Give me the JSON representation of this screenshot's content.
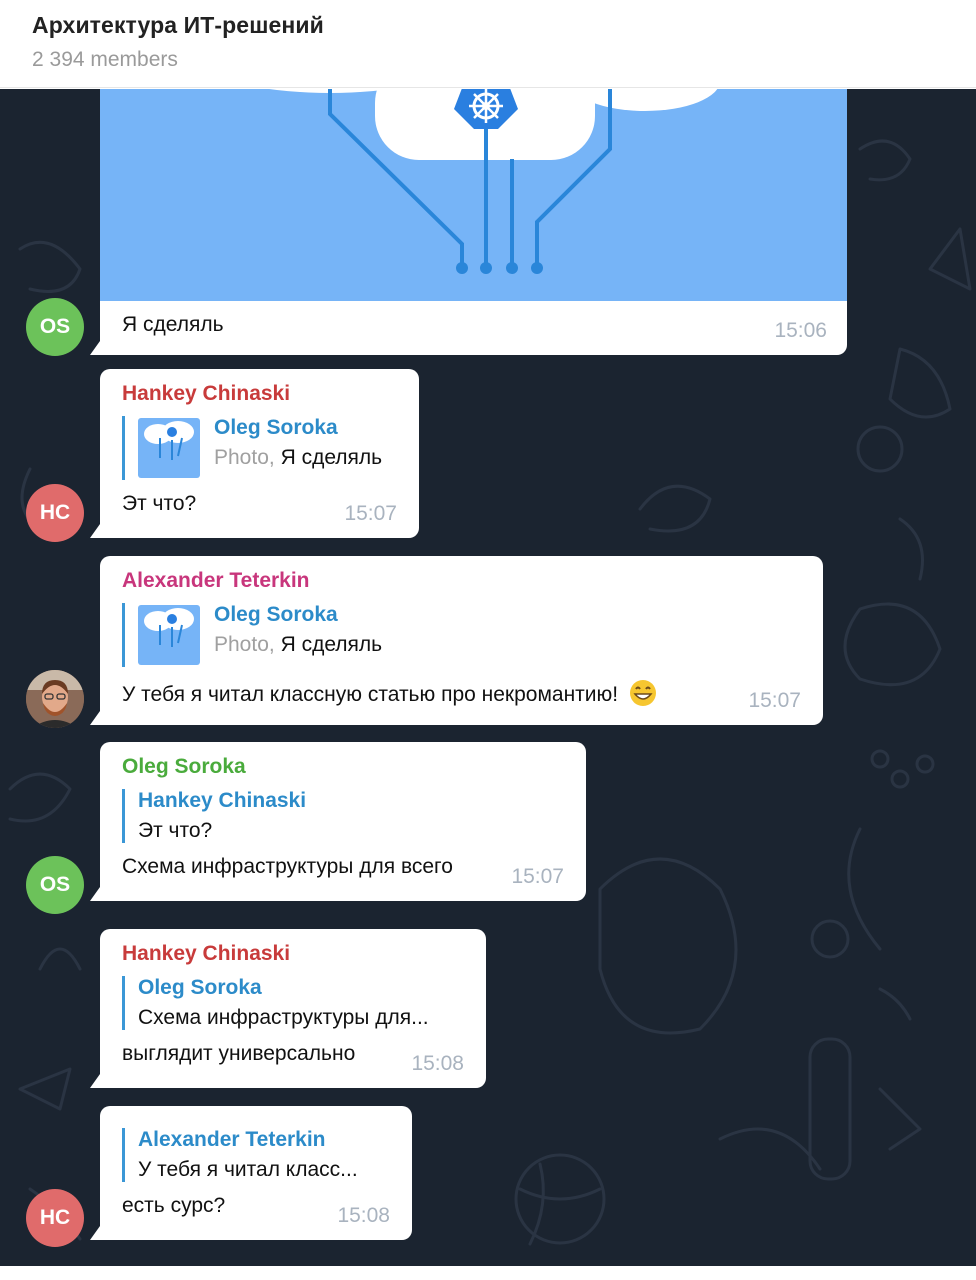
{
  "header": {
    "title": "Архитектура ИТ-решений",
    "members": "2 394 members"
  },
  "messages": [
    {
      "text": "Я сделяль",
      "time": "15:06",
      "avatar": "OS"
    },
    {
      "sender": "Hankey Chinaski",
      "sender_color": "#c83b3b",
      "reply_name": "Oleg Soroka",
      "reply_muted": "Photo, ",
      "reply_text": "Я сделяль",
      "text": "Эт что?",
      "time": "15:07",
      "avatar": "HC"
    },
    {
      "sender": "Alexander Teterkin",
      "sender_color": "#c8367c",
      "reply_name": "Oleg Soroka",
      "reply_muted": "Photo, ",
      "reply_text": "Я сделяль",
      "text": "У тебя я читал классную статью про некромантию!",
      "time": "15:07"
    },
    {
      "sender": "Oleg Soroka",
      "sender_color": "#4aab3c",
      "reply_name": "Hankey Chinaski",
      "reply_text": "Эт что?",
      "text": "Схема инфраструктуры для всего",
      "time": "15:07",
      "avatar": "OS"
    },
    {
      "sender": "Hankey Chinaski",
      "sender_color": "#c83b3b",
      "reply_name": "Oleg Soroka",
      "reply_text": "Схема инфраструктуры для...",
      "text": "выглядит универсально",
      "time": "15:08"
    },
    {
      "reply_name": "Alexander Teterkin",
      "reply_text": "У тебя я читал класс...",
      "text": "есть сурс?",
      "time": "15:08",
      "avatar": "HC"
    }
  ]
}
